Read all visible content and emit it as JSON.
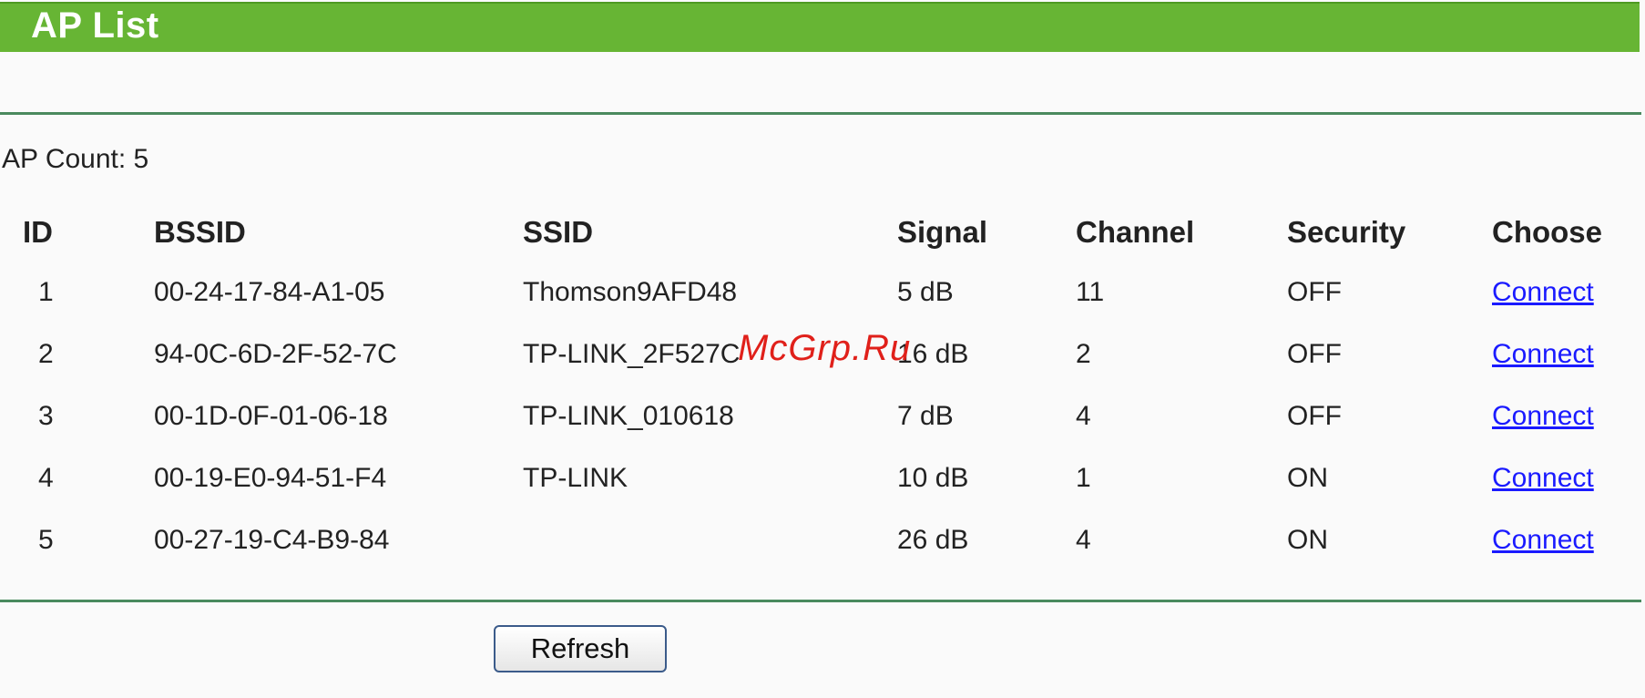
{
  "header": {
    "title": "AP List"
  },
  "ap_count": "AP Count: 5",
  "table": {
    "columns": [
      "ID",
      "BSSID",
      "SSID",
      "Signal",
      "Channel",
      "Security",
      "Choose"
    ],
    "rows": [
      {
        "id": "1",
        "bssid": "00-24-17-84-A1-05",
        "ssid": "Thomson9AFD48",
        "signal": "5 dB",
        "channel": "11",
        "security": "OFF",
        "choose": "Connect"
      },
      {
        "id": "2",
        "bssid": "94-0C-6D-2F-52-7C",
        "ssid": "TP-LINK_2F527C",
        "signal": "16 dB",
        "channel": "2",
        "security": "OFF",
        "choose": "Connect"
      },
      {
        "id": "3",
        "bssid": "00-1D-0F-01-06-18",
        "ssid": "TP-LINK_010618",
        "signal": "7 dB",
        "channel": "4",
        "security": "OFF",
        "choose": "Connect"
      },
      {
        "id": "4",
        "bssid": "00-19-E0-94-51-F4",
        "ssid": "TP-LINK",
        "signal": "10 dB",
        "channel": "1",
        "security": "ON",
        "choose": "Connect"
      },
      {
        "id": "5",
        "bssid": "00-27-19-C4-B9-84",
        "ssid": "",
        "signal": "26 dB",
        "channel": "4",
        "security": "ON",
        "choose": "Connect"
      }
    ]
  },
  "watermark": "McGrp.Ru",
  "refresh_label": "Refresh",
  "colors": {
    "title_bar": "#67b534",
    "divider": "#4a8a5e",
    "link": "#1a1aff",
    "watermark": "#e0201a"
  }
}
